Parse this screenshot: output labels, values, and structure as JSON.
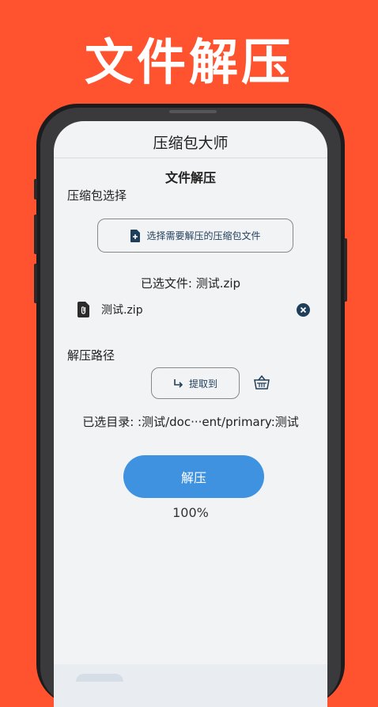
{
  "banner": {
    "title": "文件解压"
  },
  "app": {
    "title": "压缩包大师"
  },
  "page": {
    "title": "文件解压"
  },
  "archive": {
    "section_label": "压缩包选择",
    "select_button_label": "选择需要解压的压缩包文件",
    "selected_file_text": "已选文件: 测试.zip",
    "file_name": "测试.zip"
  },
  "extract": {
    "section_label": "解压路径",
    "extract_to_label": "提取到",
    "selected_dir_text": "已选目录: :测试/doc···ent/primary:测试"
  },
  "action": {
    "unzip_label": "解压",
    "progress": "100%"
  },
  "colors": {
    "background": "#FF522E",
    "primary": "#3F92E0",
    "icon_dark": "#1f3e5a"
  }
}
